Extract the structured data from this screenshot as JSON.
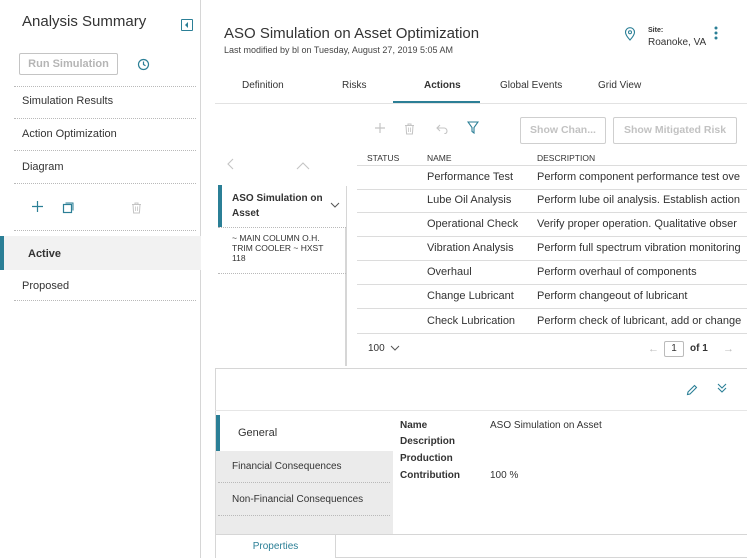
{
  "left_panel": {
    "title": "Analysis Summary",
    "run_simulation_label": "Run Simulation",
    "menu": [
      "Simulation Results",
      "Action Optimization",
      "Diagram"
    ],
    "states": {
      "active": "Active",
      "proposed": "Proposed"
    }
  },
  "header": {
    "title": "ASO Simulation on Asset Optimization",
    "subtitle": "Last modified by bl on Tuesday, August 27, 2019 5:05 AM",
    "site_label": "Site:",
    "site_value": "Roanoke, VA"
  },
  "tabs": [
    "Definition",
    "Risks",
    "Actions",
    "Global Events",
    "Grid View"
  ],
  "active_tab": "Actions",
  "toolbar": {
    "show_changes_label": "Show Chan...",
    "show_mitigated_label": "Show Mitigated Risk"
  },
  "navigator": {
    "asset_label": "ASO Simulation on Asset",
    "child_label": "~ MAIN COLUMN O.H. TRIM COOLER ~ HXST 118"
  },
  "grid": {
    "columns": [
      "STATUS",
      "NAME",
      "DESCRIPTION"
    ],
    "rows": [
      {
        "name": "Performance Test",
        "description": "Perform component performance test ove"
      },
      {
        "name": "Lube Oil Analysis",
        "description": "Perform lube oil analysis. Establish action"
      },
      {
        "name": "Operational Check",
        "description": "Verify proper operation. Qualitative obser"
      },
      {
        "name": "Vibration Analysis",
        "description": "Perform full spectrum vibration monitoring"
      },
      {
        "name": "Overhaul",
        "description": "Perform overhaul of components"
      },
      {
        "name": "Change Lubricant",
        "description": "Perform changeout of lubricant"
      },
      {
        "name": "Check Lubrication",
        "description": "Perform check of lubricant, add or change"
      }
    ],
    "page_size": "100",
    "current_page": "1",
    "page_of": "of 1"
  },
  "details": {
    "side_tabs": [
      "General",
      "Financial Consequences",
      "Non-Financial Consequences"
    ],
    "properties": [
      {
        "key": "Name",
        "value": "ASO Simulation on Asset"
      },
      {
        "key": "Description",
        "value": ""
      },
      {
        "key": "Production",
        "value": ""
      },
      {
        "key": "Contribution",
        "value": "100 %"
      }
    ],
    "bottom_tab": "Properties"
  },
  "colors": {
    "accent": "#2b7f96",
    "disabled": "#c2c2c2"
  },
  "icons": [
    "collapse-panel-icon",
    "history-icon",
    "add-icon",
    "copy-icon",
    "trash-icon",
    "location-pin-icon",
    "kebab-menu-icon",
    "undo-icon",
    "filter-icon",
    "chevron-left-icon",
    "chevron-up-icon",
    "chevron-down-icon",
    "edit-pencil-icon",
    "double-chevron-down-icon"
  ]
}
